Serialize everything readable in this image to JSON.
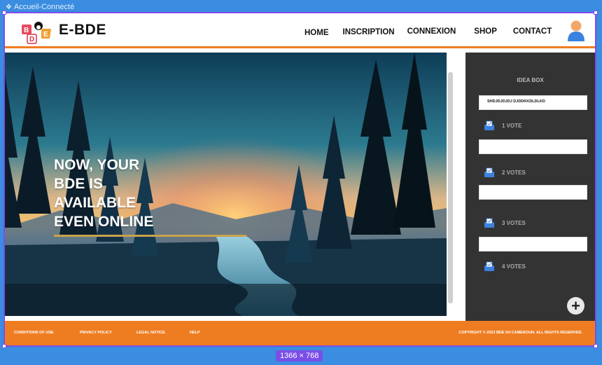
{
  "canvas": {
    "frame_label": "Accueil-Connecté",
    "size_badge": "1366 × 768"
  },
  "header": {
    "brand": "E-BDE",
    "menu": [
      "HOME",
      "INSCRIPTION",
      "CONNEXION",
      "SHOP",
      "CONTACT"
    ],
    "nav_color": "#ee7d22"
  },
  "hero": {
    "lines": [
      "NOW, YOUR",
      "BDE IS",
      "AVAILABLE",
      "EVEN ONLINE"
    ],
    "underline_color": "#c9a24a"
  },
  "idea_box": {
    "title": "IDEA BOX",
    "first_idea": "SHDJDJDJDJ DJDDKKDLDLKD",
    "votes": [
      "1 VOTE",
      "2 VOTES",
      "3 VOTES",
      "4 VOTES"
    ],
    "add_icon": "plus-icon",
    "background": "#333333"
  },
  "footer": {
    "links": [
      "CONDITIONS OF USE",
      "PRIVACY POLICY",
      "LEGAL NOTICE",
      "HELP"
    ],
    "copyright": "COPYRIGHT © 2023 BDE IUI CAMEROUN. ALL RIGHTS RESERVED.",
    "background": "#ee7d22"
  }
}
